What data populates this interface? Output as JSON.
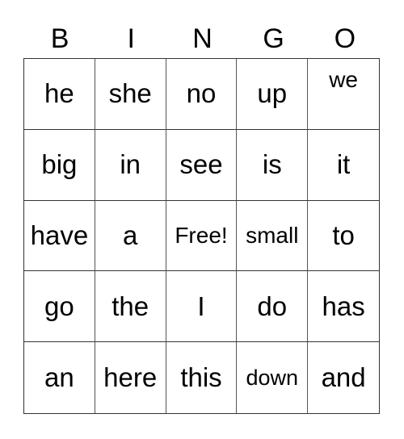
{
  "header": [
    "B",
    "I",
    "N",
    "G",
    "O"
  ],
  "cells": [
    {
      "text": "he"
    },
    {
      "text": "she"
    },
    {
      "text": "no"
    },
    {
      "text": "up"
    },
    {
      "text": "we",
      "style": "top"
    },
    {
      "text": "big"
    },
    {
      "text": "in"
    },
    {
      "text": "see"
    },
    {
      "text": "is"
    },
    {
      "text": "it"
    },
    {
      "text": "have"
    },
    {
      "text": "a"
    },
    {
      "text": "Free!",
      "style": "sm"
    },
    {
      "text": "small",
      "style": "sm"
    },
    {
      "text": "to"
    },
    {
      "text": "go"
    },
    {
      "text": "the"
    },
    {
      "text": "I"
    },
    {
      "text": "do"
    },
    {
      "text": "has"
    },
    {
      "text": "an"
    },
    {
      "text": "here"
    },
    {
      "text": "this"
    },
    {
      "text": "down",
      "style": "xs"
    },
    {
      "text": "and"
    }
  ]
}
